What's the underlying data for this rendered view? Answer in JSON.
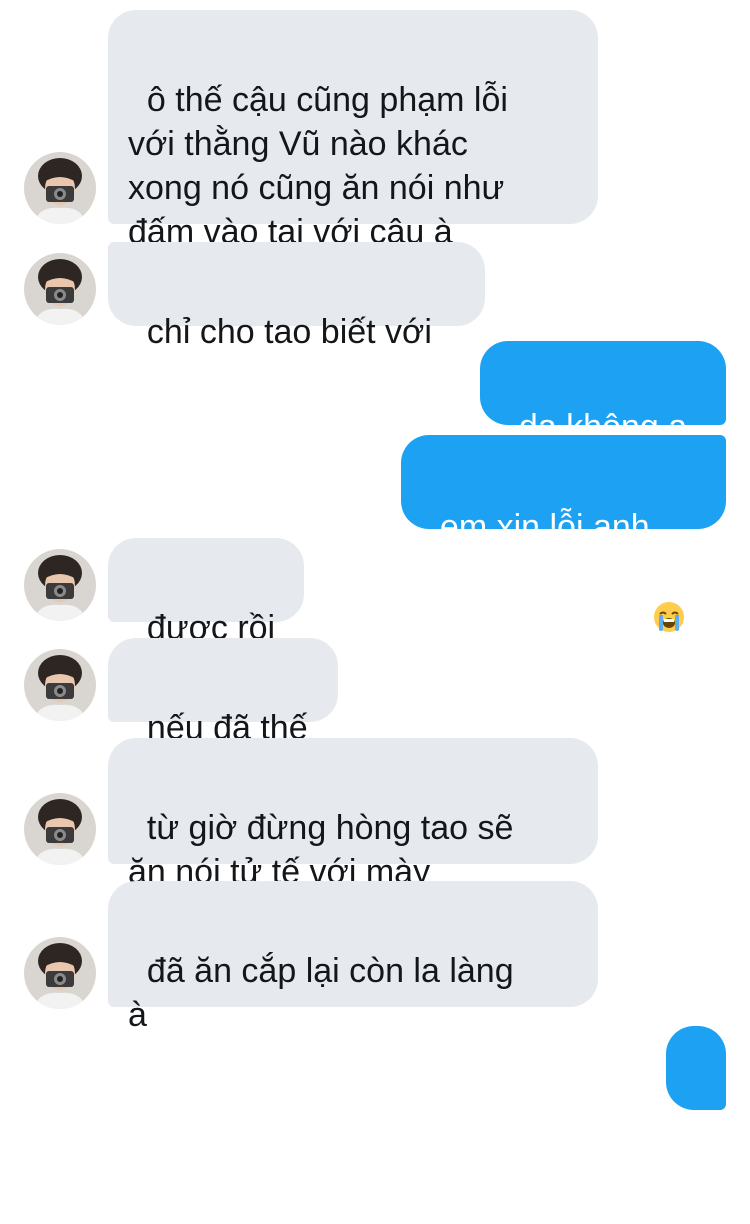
{
  "conversation": {
    "messages": [
      {
        "sender": "them",
        "text": "ô thế cậu cũng phạm lỗi\nvới thằng Vũ nào khác\nxong nó cũng ăn nói như\nđấm vào tai với cậu à"
      },
      {
        "sender": "them",
        "text": "chỉ cho tao biết với"
      },
      {
        "sender": "me",
        "text": "dạ không ạ"
      },
      {
        "sender": "me",
        "text": "em xin lỗi anh",
        "emoji": "loudly-crying-face-emoji"
      },
      {
        "sender": "them",
        "text": "được rồi"
      },
      {
        "sender": "them",
        "text": "nếu đã thế"
      },
      {
        "sender": "them",
        "text": "từ giờ đừng hòng tao sẽ\năn nói tử tế với mày"
      },
      {
        "sender": "them",
        "text": "đã ăn cắp lại còn la làng\nà"
      },
      {
        "sender": "me",
        "text": "?"
      }
    ]
  },
  "colors": {
    "incoming_bubble": "#e6eaee",
    "outgoing_bubble": "#1da1f2",
    "incoming_text": "#14171a",
    "outgoing_text": "#ffffff",
    "background": "#ffffff"
  },
  "icons": {
    "avatar": "profile-photo-person-with-camera",
    "emoji": "loudly-crying-face-emoji"
  }
}
